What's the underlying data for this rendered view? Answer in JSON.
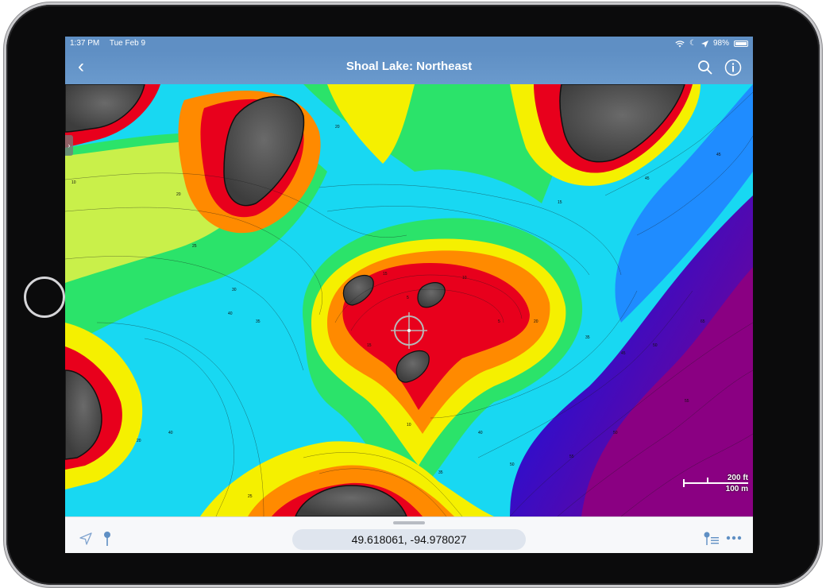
{
  "status_bar": {
    "time": "1:37 PM",
    "date": "Tue Feb 9",
    "battery": "98%"
  },
  "nav": {
    "title": "Shoal Lake: Northeast",
    "back_icon": "chevron-left-icon",
    "search_icon": "search-icon",
    "info_icon": "info-icon"
  },
  "map": {
    "depth_labels": [
      "5",
      "10",
      "15",
      "20",
      "25",
      "30",
      "35",
      "40",
      "45",
      "50",
      "55",
      "65"
    ],
    "scale": {
      "imperial": "200 ft",
      "metric": "100 m"
    },
    "colors": {
      "land": "#505050",
      "shallow": "#e8001c",
      "orange": "#ff8a00",
      "yellow": "#f5f000",
      "green": "#2be36a",
      "cyan": "#18d8f2",
      "blue": "#1f63ff",
      "deep_blue": "#2a0fd0",
      "deepest": "#8a0082"
    }
  },
  "bottom_bar": {
    "coordinates": "49.618061, -94.978027",
    "locate_icon": "location-arrow-icon",
    "pin_icon": "pin-icon",
    "pin_list_icon": "pin-list-icon",
    "more_icon": "more-icon"
  }
}
